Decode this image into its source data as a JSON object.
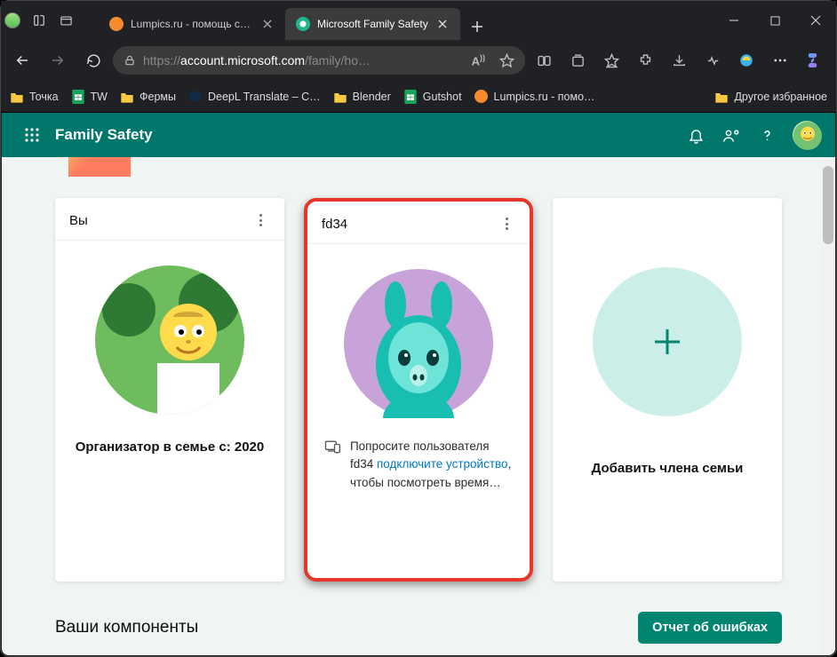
{
  "tabs": [
    {
      "title": "Lumpics.ru - помощь с компьют",
      "favicon_color": "#f58b2f"
    },
    {
      "title": "Microsoft Family Safety",
      "favicon_color": "#1fb58f"
    }
  ],
  "url": {
    "scheme": "https://",
    "host": "account.microsoft.com",
    "path": "/family/ho…"
  },
  "bookmarks": [
    {
      "label": "Точка",
      "icon": "folder"
    },
    {
      "label": "TW",
      "icon": "sheet"
    },
    {
      "label": "Фермы",
      "icon": "folder"
    },
    {
      "label": "DeepL Translate – C…",
      "icon": "deepl"
    },
    {
      "label": "Blender",
      "icon": "folder"
    },
    {
      "label": "Gutshot",
      "icon": "sheet"
    },
    {
      "label": "Lumpics.ru - помо…",
      "icon": "lumpics"
    }
  ],
  "bookmarks_overflow": "Другое избранное",
  "page": {
    "brand": "Family Safety",
    "cards": {
      "you": {
        "title": "Вы",
        "caption": "Организатор в семье с: 2020"
      },
      "member": {
        "title": "fd34",
        "request_prefix": "Попросите пользователя fd34 ",
        "request_link": "подключите устройство",
        "request_suffix": ", чтобы посмотреть время…"
      },
      "add": {
        "caption": "Добавить члена семьи"
      }
    },
    "components_title": "Ваши компоненты",
    "report_button": "Отчет об ошибках"
  }
}
